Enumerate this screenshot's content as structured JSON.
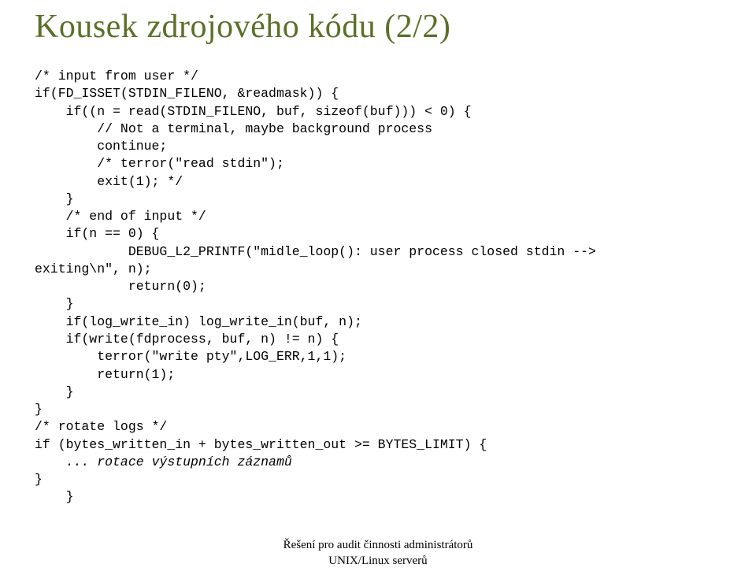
{
  "title": "Kousek zdrojového kódu (2/2)",
  "code": {
    "l01": "/* input from user */",
    "l02": "if(FD_ISSET(STDIN_FILENO, &readmask)) {",
    "l03": "    if((n = read(STDIN_FILENO, buf, sizeof(buf))) < 0) {",
    "l04": "        // Not a terminal, maybe background process",
    "l05": "        continue;",
    "l06": "        /* terror(\"read stdin\");",
    "l07": "        exit(1); */",
    "l08": "    }",
    "l09": "    /* end of input */",
    "l10": "    if(n == 0) {",
    "l11": "            DEBUG_L2_PRINTF(\"midle_loop(): user process closed stdin --> ",
    "l11b": "exiting\\n\", n);",
    "l12": "            return(0);",
    "l13": "    }",
    "l14": "    if(log_write_in) log_write_in(buf, n);",
    "l15": "    if(write(fdprocess, buf, n) != n) {",
    "l16": "        terror(\"write pty\",LOG_ERR,1,1);",
    "l17": "        return(1);",
    "l18": "    }",
    "l19": "}",
    "l20": "/* rotate logs */",
    "l21": "if (bytes_written_in + bytes_written_out >= BYTES_LIMIT) {",
    "l22": "    ... rotace výstupních záznamů",
    "l23": "}",
    "l24": "    }"
  },
  "footer": {
    "line1": "Řešení pro audit činnosti administrátorů",
    "line2": "UNIX/Linux serverů"
  }
}
